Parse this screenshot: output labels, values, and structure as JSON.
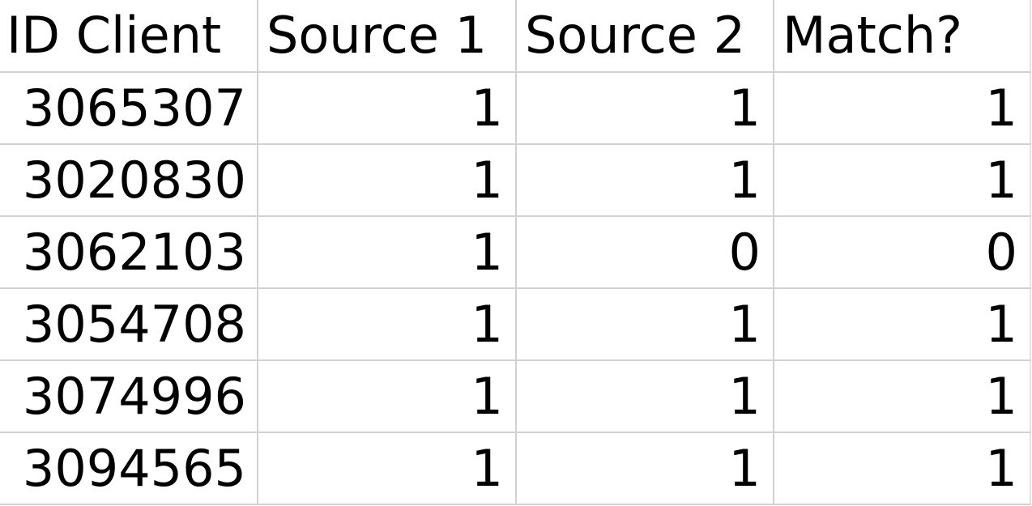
{
  "table": {
    "name": "client-source-match-table",
    "columns": [
      {
        "key": "id_client",
        "label": "ID Client",
        "align": "left"
      },
      {
        "key": "source_1",
        "label": "Source 1",
        "align": "right"
      },
      {
        "key": "source_2",
        "label": "Source 2",
        "align": "right"
      },
      {
        "key": "match",
        "label": "Match?",
        "align": "right"
      }
    ],
    "rows": [
      {
        "id_client": "3065307",
        "source_1": "1",
        "source_2": "1",
        "match": "1"
      },
      {
        "id_client": "3020830",
        "source_1": "1",
        "source_2": "1",
        "match": "1"
      },
      {
        "id_client": "3062103",
        "source_1": "1",
        "source_2": "0",
        "match": "0"
      },
      {
        "id_client": "3054708",
        "source_1": "1",
        "source_2": "1",
        "match": "1"
      },
      {
        "id_client": "3074996",
        "source_1": "1",
        "source_2": "1",
        "match": "1"
      },
      {
        "id_client": "3094565",
        "source_1": "1",
        "source_2": "1",
        "match": "1"
      }
    ]
  },
  "colors": {
    "text": "#000000",
    "background": "#ffffff",
    "grid_line": "#d2d2d2",
    "outer_edge": "#e4e4e4"
  }
}
